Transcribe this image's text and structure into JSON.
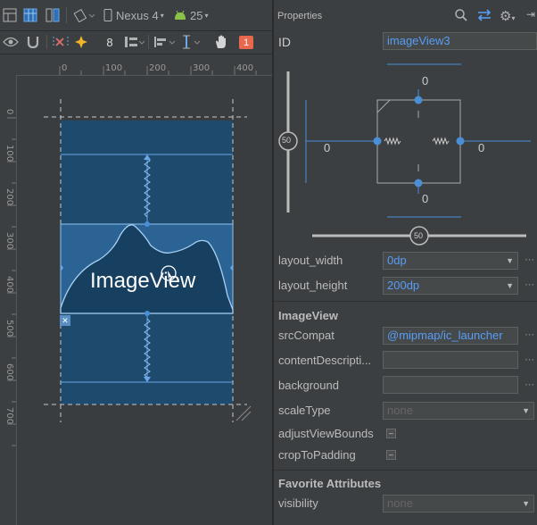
{
  "toolbar": {
    "device": "Nexus 4",
    "api_level": "25",
    "margin_value": "8",
    "notification_count": "1"
  },
  "rulers": {
    "horizontal": [
      "0",
      "100",
      "200",
      "300",
      "400"
    ],
    "vertical": [
      "0",
      "100",
      "200",
      "300",
      "400",
      "500",
      "600",
      "700"
    ]
  },
  "canvas": {
    "widget_label": "ImageView"
  },
  "properties": {
    "title": "Properties",
    "id_label": "ID",
    "id_value": "imageView3",
    "constraints": {
      "top": "0",
      "bottom": "0",
      "left": "0",
      "right": "0",
      "vertical_bias": "50",
      "horizontal_bias": "50"
    },
    "rows": [
      {
        "label": "layout_width",
        "value": "0dp"
      },
      {
        "label": "layout_height",
        "value": "200dp"
      }
    ],
    "imageview_section": "ImageView",
    "src_compat_label": "srcCompat",
    "src_compat_value": "@mipmap/ic_launcher",
    "content_description_label": "contentDescripti...",
    "background_label": "background",
    "scale_type_label": "scaleType",
    "scale_type_value": "none",
    "adjust_view_bounds_label": "adjustViewBounds",
    "adjust_view_bounds_value": "–",
    "crop_to_padding_label": "cropToPadding",
    "crop_to_padding_value": "–",
    "favorite_section": "Favorite Attributes",
    "visibility_label": "visibility",
    "visibility_value": "none"
  },
  "colors": {
    "accent": "#589df6",
    "blueprint": "#1e4a6e",
    "image_band": "#2b6494",
    "constraint_line": "#4a8fd6"
  }
}
